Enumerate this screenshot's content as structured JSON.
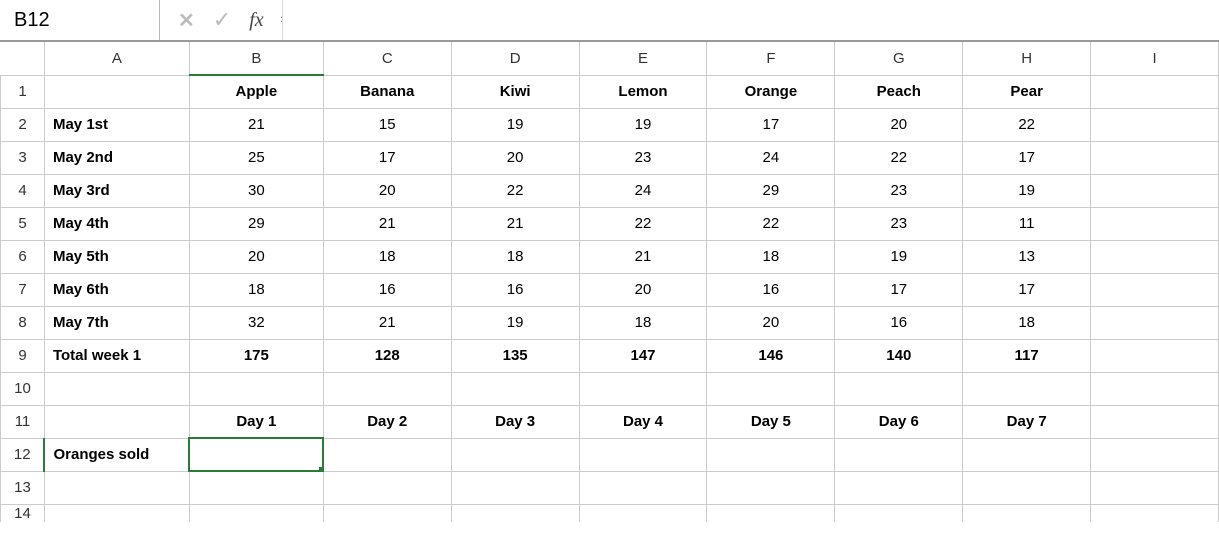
{
  "nameBox": "B12",
  "formulaInput": "",
  "fxLabel": "fx",
  "columns": [
    "A",
    "B",
    "C",
    "D",
    "E",
    "F",
    "G",
    "H",
    "I"
  ],
  "rowNumbers": [
    "1",
    "2",
    "3",
    "4",
    "5",
    "6",
    "7",
    "8",
    "9",
    "10",
    "11",
    "12",
    "13",
    "14"
  ],
  "selectedCell": "B12",
  "grid": {
    "r1": {
      "B": "Apple",
      "C": "Banana",
      "D": "Kiwi",
      "E": "Lemon",
      "F": "Orange",
      "G": "Peach",
      "H": "Pear"
    },
    "r2": {
      "A": "May 1st",
      "B": "21",
      "C": "15",
      "D": "19",
      "E": "19",
      "F": "17",
      "G": "20",
      "H": "22"
    },
    "r3": {
      "A": "May 2nd",
      "B": "25",
      "C": "17",
      "D": "20",
      "E": "23",
      "F": "24",
      "G": "22",
      "H": "17"
    },
    "r4": {
      "A": "May 3rd",
      "B": "30",
      "C": "20",
      "D": "22",
      "E": "24",
      "F": "29",
      "G": "23",
      "H": "19"
    },
    "r5": {
      "A": "May 4th",
      "B": "29",
      "C": "21",
      "D": "21",
      "E": "22",
      "F": "22",
      "G": "23",
      "H": "11"
    },
    "r6": {
      "A": "May 5th",
      "B": "20",
      "C": "18",
      "D": "18",
      "E": "21",
      "F": "18",
      "G": "19",
      "H": "13"
    },
    "r7": {
      "A": "May 6th",
      "B": "18",
      "C": "16",
      "D": "16",
      "E": "20",
      "F": "16",
      "G": "17",
      "H": "17"
    },
    "r8": {
      "A": "May 7th",
      "B": "32",
      "C": "21",
      "D": "19",
      "E": "18",
      "F": "20",
      "G": "16",
      "H": "18"
    },
    "r9": {
      "A": "Total week 1",
      "B": "175",
      "C": "128",
      "D": "135",
      "E": "147",
      "F": "146",
      "G": "140",
      "H": "117"
    },
    "r11": {
      "B": "Day 1",
      "C": "Day 2",
      "D": "Day 3",
      "E": "Day 4",
      "F": "Day 5",
      "G": "Day 6",
      "H": "Day 7"
    },
    "r12": {
      "A": "Oranges sold"
    }
  },
  "chart_data": {
    "type": "table",
    "title": "Fruit sales by day",
    "columns": [
      "Apple",
      "Banana",
      "Kiwi",
      "Lemon",
      "Orange",
      "Peach",
      "Pear"
    ],
    "rows": [
      "May 1st",
      "May 2nd",
      "May 3rd",
      "May 4th",
      "May 5th",
      "May 6th",
      "May 7th"
    ],
    "values": [
      [
        21,
        15,
        19,
        19,
        17,
        20,
        22
      ],
      [
        25,
        17,
        20,
        23,
        24,
        22,
        17
      ],
      [
        30,
        20,
        22,
        24,
        29,
        23,
        19
      ],
      [
        29,
        21,
        21,
        22,
        22,
        23,
        11
      ],
      [
        20,
        18,
        18,
        21,
        18,
        19,
        13
      ],
      [
        18,
        16,
        16,
        20,
        16,
        17,
        17
      ],
      [
        32,
        21,
        19,
        18,
        20,
        16,
        18
      ]
    ],
    "totals_label": "Total week 1",
    "totals": [
      175,
      128,
      135,
      147,
      146,
      140,
      117
    ],
    "secondary_header": [
      "Day 1",
      "Day 2",
      "Day 3",
      "Day 4",
      "Day 5",
      "Day 6",
      "Day 7"
    ],
    "secondary_row_label": "Oranges sold"
  }
}
